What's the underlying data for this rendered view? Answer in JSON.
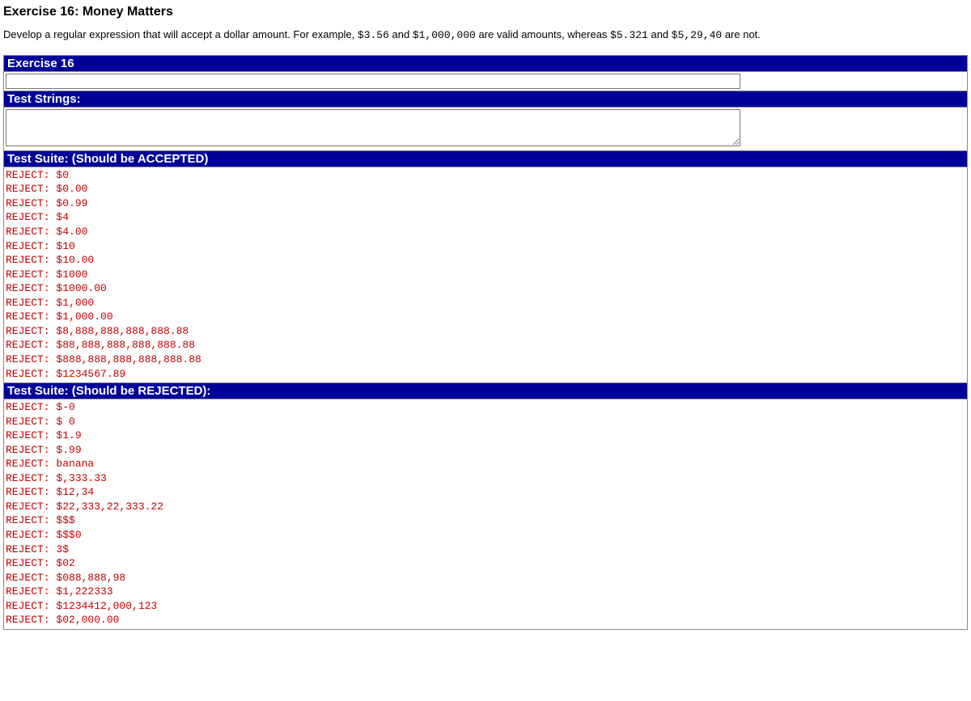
{
  "title": "Exercise 16: Money Matters",
  "intro": {
    "pre": "Develop a regular expression that will accept a dollar amount. For example, ",
    "ex1": "$3.56",
    "mid1": " and ",
    "ex2": "$1,000,000",
    "mid2": " are valid amounts, whereas ",
    "ex3": "$5.321",
    "mid3": " and ",
    "ex4": "$5,29,40",
    "post": " are not."
  },
  "bars": {
    "exercise": "Exercise 16",
    "test_strings": "Test Strings:",
    "accepted": "Test Suite: (Should be ACCEPTED)",
    "rejected": "Test Suite: (Should be REJECTED):"
  },
  "inputs": {
    "regex_value": "",
    "tests_value": ""
  },
  "accepted_lines": [
    "REJECT: $0",
    "REJECT: $0.00",
    "REJECT: $0.99",
    "REJECT: $4",
    "REJECT: $4.00",
    "REJECT: $10",
    "REJECT: $10.00",
    "REJECT: $1000",
    "REJECT: $1000.00",
    "REJECT: $1,000",
    "REJECT: $1,000.00",
    "REJECT: $8,888,888,888,888.88",
    "REJECT: $88,888,888,888,888.88",
    "REJECT: $888,888,888,888,888.88",
    "REJECT: $1234567.89"
  ],
  "rejected_lines": [
    "REJECT: $-0",
    "REJECT: $ 0",
    "REJECT: $1.9",
    "REJECT: $.99",
    "REJECT: banana",
    "REJECT: $,333.33",
    "REJECT: $12,34",
    "REJECT: $22,333,22,333.22",
    "REJECT: $$$",
    "REJECT: $$$0",
    "REJECT: 3$",
    "REJECT: $02",
    "REJECT: $088,888,98",
    "REJECT: $1,222333",
    "REJECT: $1234412,000,123",
    "REJECT: $02,000.00"
  ]
}
